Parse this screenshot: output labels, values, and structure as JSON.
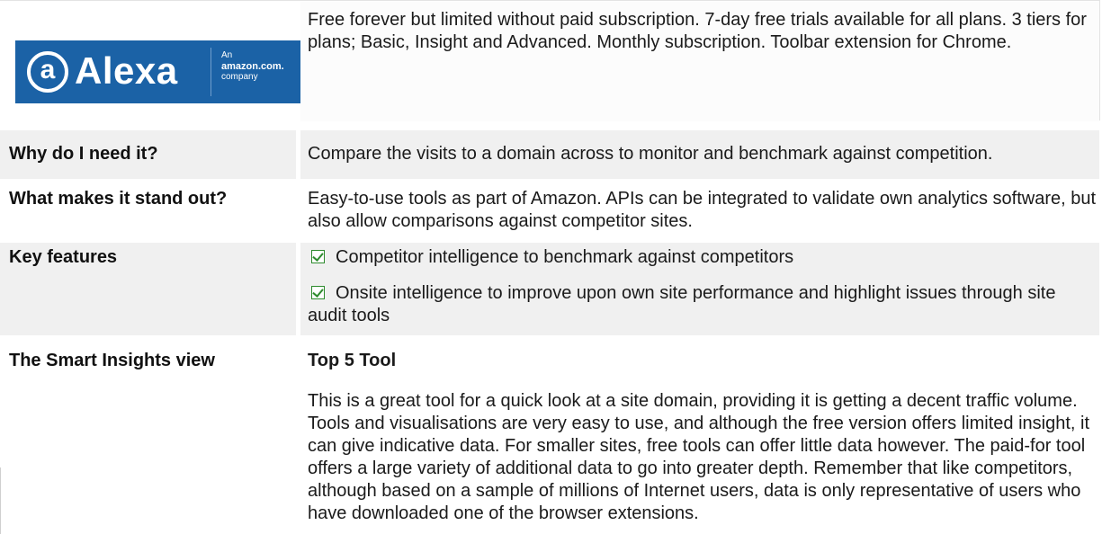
{
  "header": {
    "logo": {
      "circle_letter": "a",
      "word": "Alexa",
      "sub_line1": "An",
      "sub_line2": "amazon.com.",
      "sub_line3": "company"
    },
    "description": "Free forever but limited without paid subscription. 7-day free trials available for all plans. 3 tiers for plans; Basic, Insight and Advanced.  Monthly subscription. Toolbar extension for Chrome."
  },
  "rows": [
    {
      "label": "Why do I need it?",
      "text": "Compare the visits to a domain across to monitor and benchmark against competition."
    },
    {
      "label": "What makes it stand out?",
      "text": "Easy-to-use tools as part of Amazon.  APIs can be integrated to validate own analytics software, but also allow comparisons against competitor sites."
    },
    {
      "label": "Key features",
      "features": [
        "Competitor intelligence to benchmark against competitors",
        "Onsite intelligence to improve upon own site performance and highlight issues through site audit tools"
      ]
    },
    {
      "label": "The Smart Insights view",
      "subheading": "Top 5 Tool",
      "text": "This is a great tool for a quick look at a site domain, providing it is getting a decent traffic volume. Tools and visualisations are very easy to use, and although the free version offers limited insight, it can give indicative data. For smaller sites, free tools can offer little data however. The paid-for tool offers a large variety of additional data to go into greater depth. Remember that like competitors, although based on a sample of millions of Internet users, data is only representative of users who have downloaded one of the browser extensions."
    }
  ],
  "colors": {
    "label_bg": "#f0f0f0",
    "logo_bg": "#1b62a6",
    "check_green": "#2e8b2e"
  }
}
